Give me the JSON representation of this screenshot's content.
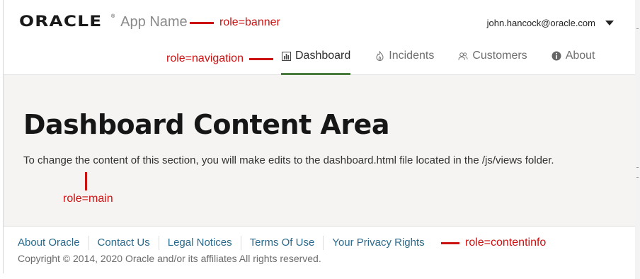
{
  "header": {
    "logo_text": "ORACLE",
    "logo_mark": "®",
    "app_name": "App Name",
    "user_email": "john.hancock@oracle.com"
  },
  "nav": {
    "items": [
      {
        "label": "Dashboard",
        "icon": "bar-chart-icon",
        "active": true
      },
      {
        "label": "Incidents",
        "icon": "fire-icon",
        "active": false
      },
      {
        "label": "Customers",
        "icon": "people-icon",
        "active": false
      },
      {
        "label": "About",
        "icon": "info-icon",
        "active": false
      }
    ]
  },
  "main": {
    "title": "Dashboard Content Area",
    "description": "To change the content of this section, you will make edits to the dashboard.html file located in the /js/views folder."
  },
  "footer": {
    "links": [
      "About Oracle",
      "Contact Us",
      "Legal Notices",
      "Terms Of Use",
      "Your Privacy Rights"
    ],
    "copyright": "Copyright © 2014, 2020 Oracle and/or its affiliates All rights reserved."
  },
  "annotations": {
    "banner": "role=banner",
    "navigation": "role=navigation",
    "main": "role=main",
    "contentinfo": "role=contentinfo"
  },
  "colors": {
    "active_tab_underline": "#4b7a3f",
    "link": "#2a6a8c",
    "annotation": "#cc1111",
    "main_background": "#f5f4f2"
  }
}
